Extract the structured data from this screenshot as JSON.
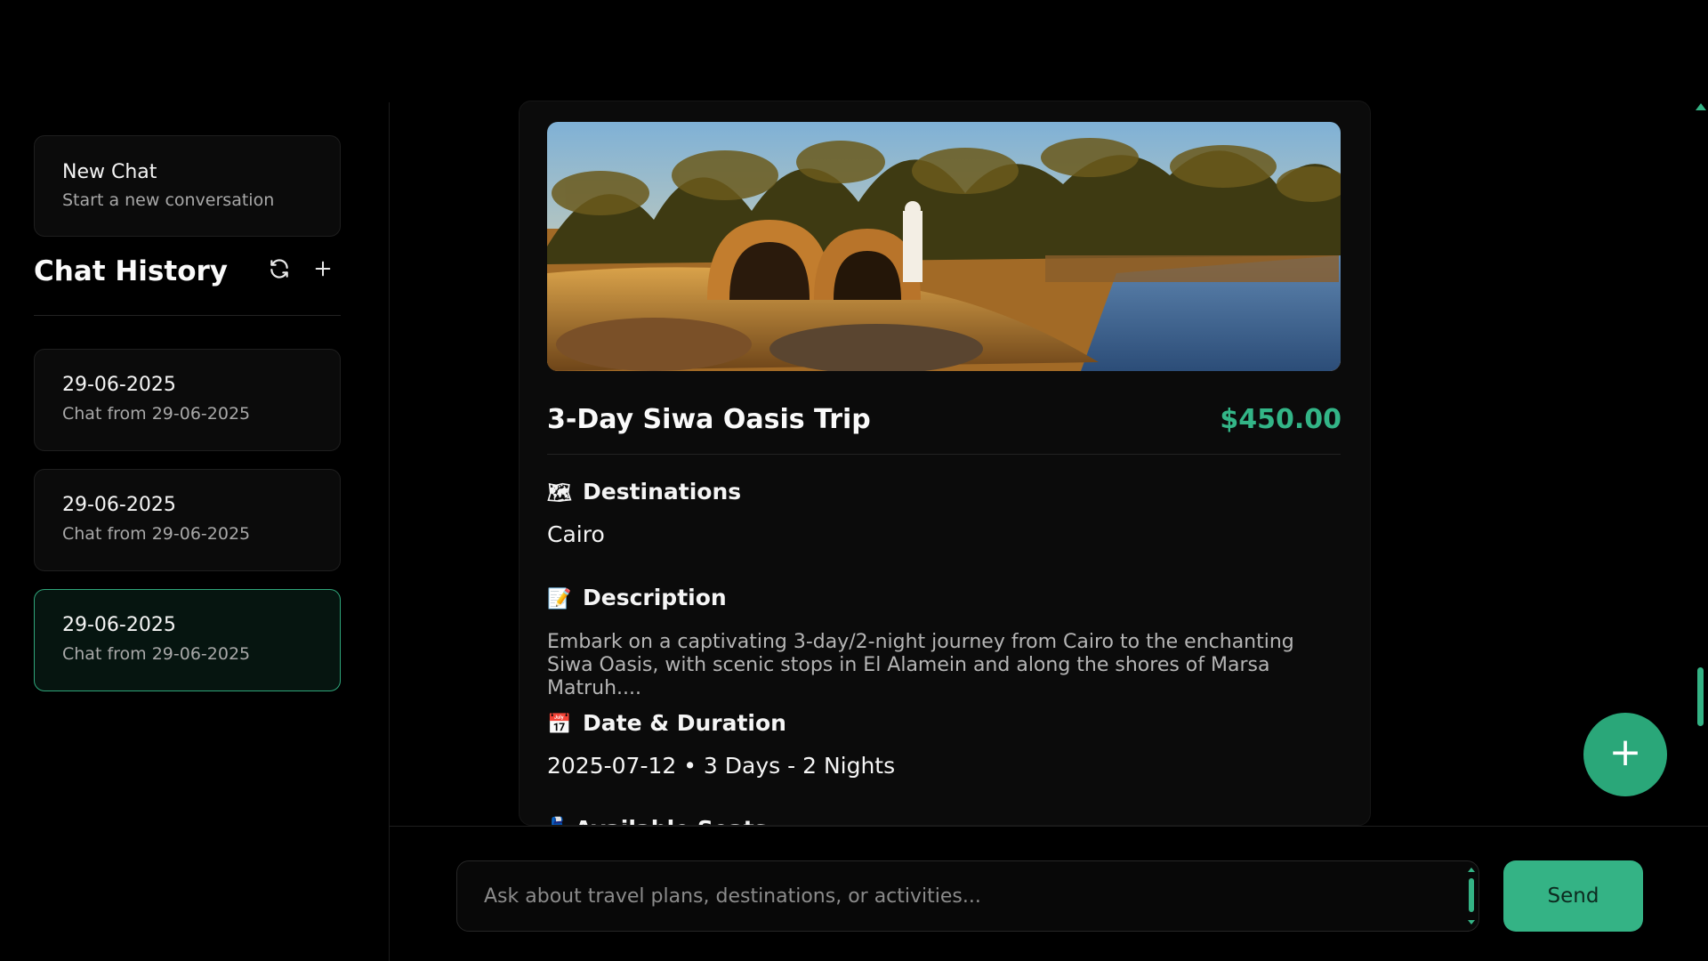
{
  "sidebar": {
    "new_chat": {
      "title": "New Chat",
      "subtitle": "Start a new conversation"
    },
    "history_title": "Chat History",
    "refresh_icon": "refresh-icon",
    "add_icon": "plus-icon",
    "items": [
      {
        "date": "29-06-2025",
        "subtitle": "Chat from 29-06-2025",
        "active": false
      },
      {
        "date": "29-06-2025",
        "subtitle": "Chat from 29-06-2025",
        "active": false
      },
      {
        "date": "29-06-2025",
        "subtitle": "Chat from 29-06-2025",
        "active": true
      }
    ]
  },
  "trip": {
    "title": "3-Day Siwa Oasis Trip",
    "price": "$450.00",
    "destinations_label": "Destinations",
    "destinations_icon": "🗺",
    "destinations_value": "Cairo",
    "description_label": "Description",
    "description_icon": "📝",
    "description_value": "Embark on a captivating 3-day/2-night journey from Cairo to the enchanting Siwa Oasis, with scenic stops in El Alamein and along the shores of Marsa Matruh....",
    "date_label": "Date & Duration",
    "date_icon": "📅",
    "date_value": "2025-07-12 • 3 Days - 2 Nights",
    "seats_label": "Available Seats",
    "seats_icon": "💺"
  },
  "composer": {
    "placeholder": "Ask about travel plans, destinations, or activities...",
    "send_label": "Send"
  },
  "fab": {
    "label": "+",
    "icon": "plus-icon"
  },
  "colors": {
    "accent": "#34b385",
    "price": "#33b587",
    "active_border": "#2fa57a",
    "background": "#000000",
    "card": "#0b0b0b"
  }
}
